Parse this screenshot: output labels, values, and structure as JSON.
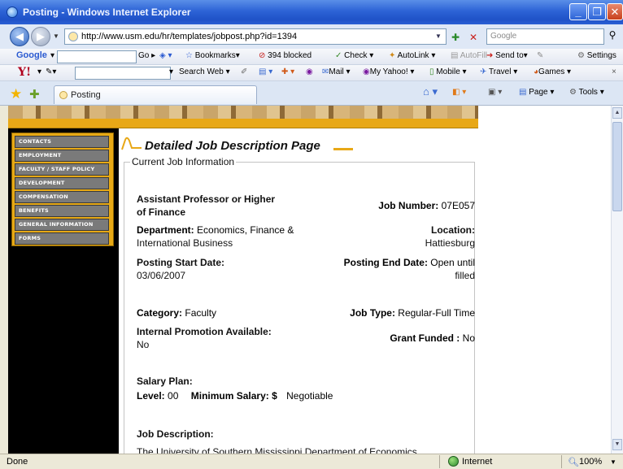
{
  "window": {
    "title": "Posting - Windows Internet Explorer",
    "buttons": {
      "minimize": "_",
      "maximize": "❐",
      "close": "✕"
    }
  },
  "address": {
    "url": "http://www.usm.edu/hr/templates/jobpost.php?id=1394",
    "search_placeholder": "Google"
  },
  "google_toolbar": {
    "logo": "Google",
    "go": "Go",
    "bookmarks": "Bookmarks",
    "blocked": "394 blocked",
    "check": "Check",
    "autolink": "AutoLink",
    "autofill": "AutoFill",
    "send_to": "Send to",
    "settings": "Settings"
  },
  "yahoo_toolbar": {
    "logo": "Y!",
    "search_web": "Search Web",
    "mail": "Mail",
    "my_yahoo": "My Yahoo!",
    "mobile": "Mobile",
    "travel": "Travel",
    "games": "Games"
  },
  "tabs": [
    {
      "label": "Posting"
    }
  ],
  "command_bar": {
    "page": "Page",
    "tools": "Tools"
  },
  "side_menu": {
    "items": [
      "CONTACTS",
      "EMPLOYMENT",
      "FACULTY / STAFF POLICY",
      "DEVELOPMENT",
      "COMPENSATION",
      "BENEFITS",
      "GENERAL INFORMATION",
      "FORMS"
    ]
  },
  "job": {
    "page_title": "Detailed Job Description Page",
    "section_title": "Current Job Information",
    "position_line1": "Assistant Professor or Higher",
    "position_line2": "of Finance",
    "job_number_label": "Job Number:",
    "job_number": "07E057",
    "department_label": "Department:",
    "department_line1": "Economics, Finance &",
    "department_line2": "International Business",
    "location_label": "Location:",
    "location": "Hattiesburg",
    "posting_start_label": "Posting Start Date:",
    "posting_start": "03/06/2007",
    "posting_end_label": "Posting End Date:",
    "posting_end_line1": "Open until",
    "posting_end_line2": "filled",
    "category_label": "Category:",
    "category": "Faculty",
    "job_type_label": "Job Type:",
    "job_type": "Regular-Full Time",
    "internal_promo_label": "Internal Promotion Available:",
    "internal_promo": "No",
    "grant_funded_label": "Grant Funded :",
    "grant_funded": "No",
    "salary_plan_label": "Salary Plan:",
    "level_label": "Level:",
    "level": "00",
    "min_salary_label": "Minimum Salary: $",
    "min_salary": "Negotiable",
    "job_description_label": "Job Description:",
    "job_description_start": "The University of Southern Mississippi Department of Economics"
  },
  "status": {
    "text": "Done",
    "zone": "Internet",
    "zoom": "100%"
  }
}
